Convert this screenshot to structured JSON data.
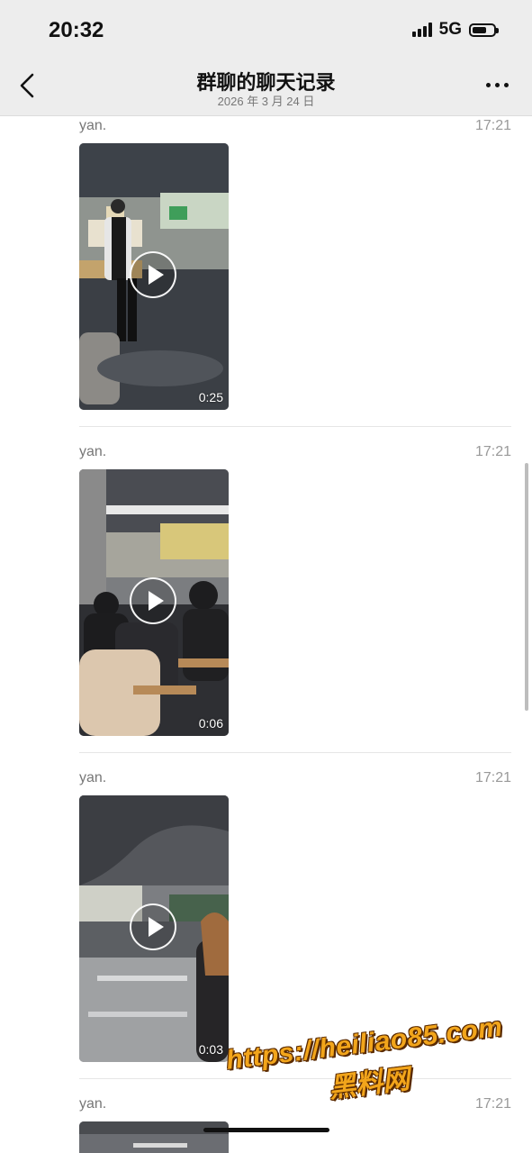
{
  "status_bar": {
    "time": "20:32",
    "network": "5G",
    "battery_level": 0.7,
    "signal_bars": 4
  },
  "nav": {
    "back_icon": "chevron-left-icon",
    "title": "群聊的聊天记录",
    "subtitle": "2026 年 3 月 24 日",
    "more_icon": "more-dots-icon"
  },
  "messages": [
    {
      "sender": "yan.",
      "time": "17:21",
      "video_duration": "0:25"
    },
    {
      "sender": "yan.",
      "time": "17:21",
      "video_duration": "0:06"
    },
    {
      "sender": "yan.",
      "time": "17:21",
      "video_duration": "0:03"
    },
    {
      "sender": "yan.",
      "time": "17:21"
    }
  ],
  "watermark": {
    "url": "https://heiliao85.com",
    "name": "黑料网",
    "color": "#f2a51b"
  },
  "colors": {
    "nav_background": "#ededed",
    "page_background": "#ffffff"
  }
}
